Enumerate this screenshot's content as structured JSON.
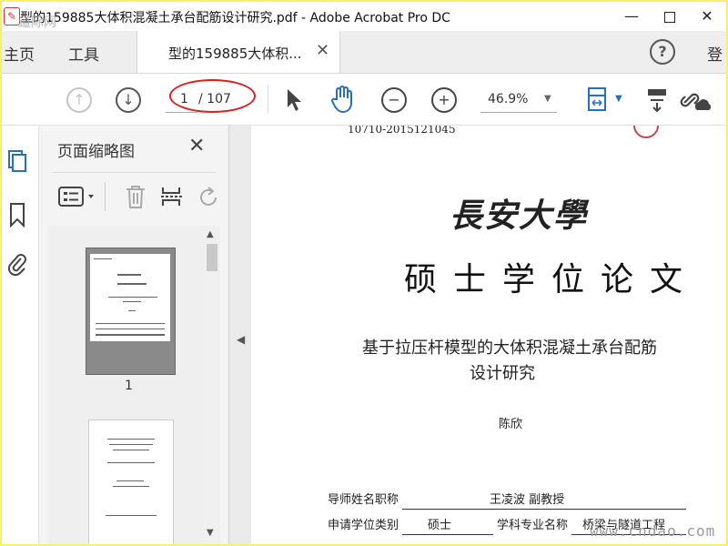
{
  "window": {
    "title": "型的159885大体积混凝土承台配筋设计研究.pdf - Adobe Acrobat Pro DC",
    "minimize": "—",
    "close": "✕"
  },
  "watermarks": {
    "top": "道际网",
    "bottom": "www.cndao.com"
  },
  "tabs": {
    "home": "主页",
    "tools": "工具",
    "document": "型的159885大体积...",
    "document_close": "✕",
    "help": "?",
    "login": "登"
  },
  "toolbar": {
    "current_page": "1",
    "total_pages": "/ 107",
    "zoom": "46.9%",
    "highlight_color": "#d92020",
    "accent_color": "#2a6ebb"
  },
  "panel": {
    "title": "页面缩略图",
    "close": "✕",
    "thumbnails": [
      {
        "label": "1"
      }
    ]
  },
  "document": {
    "id_line": "10710-2015121045",
    "university": "長安大學",
    "degree_title": "硕士学位论文",
    "thesis_title_line1": "基于拉压杆模型的大体积混凝土承台配筋",
    "thesis_title_line2": "设计研究",
    "author": "陈欣",
    "fields": {
      "advisor_label": "导师姓名职称",
      "advisor_value": "王凌波  副教授",
      "degree_type_label": "申请学位类别",
      "degree_type_value": "硕士",
      "major_label": "学科专业名称",
      "major_value": "桥梁与隧道工程"
    }
  }
}
